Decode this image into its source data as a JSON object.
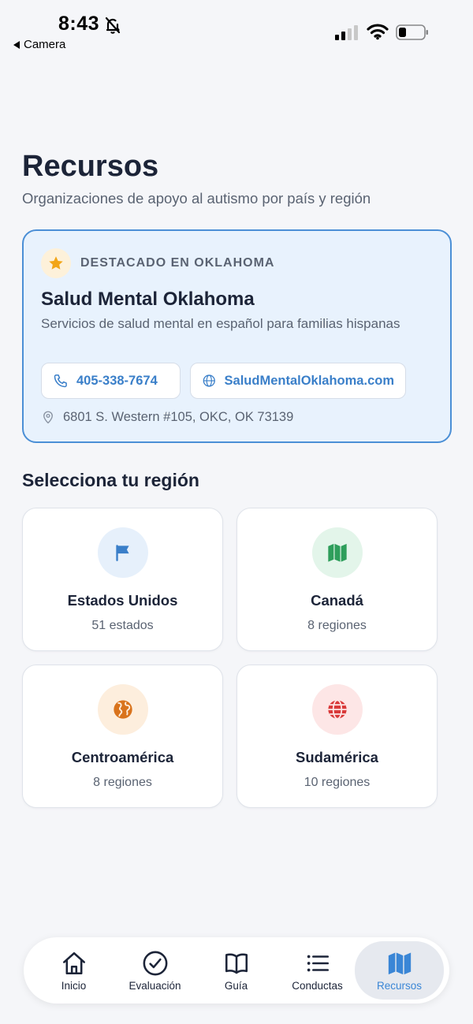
{
  "status_bar": {
    "time": "8:43",
    "back_label": "Camera"
  },
  "header": {
    "title": "Recursos",
    "subtitle": "Organizaciones de apoyo al autismo por país y región"
  },
  "featured": {
    "label": "DESTACADO EN OKLAHOMA",
    "name": "Salud Mental Oklahoma",
    "description": "Servicios de salud mental en español para familias hispanas",
    "phone": "405-338-7674",
    "website": "SaludMentalOklahoma.com",
    "address": "6801 S. Western #105, OKC, OK 73139"
  },
  "regions": {
    "title": "Selecciona tu región",
    "items": [
      {
        "name": "Estados Unidos",
        "count": "51 estados",
        "icon": "flag-icon",
        "color": "#3a7fc9",
        "bg": "#e6f0fb"
      },
      {
        "name": "Canadá",
        "count": "8 regiones",
        "icon": "map-icon",
        "color": "#2e9e5b",
        "bg": "#e3f5ea"
      },
      {
        "name": "Centroamérica",
        "count": "8 regiones",
        "icon": "globe-americas-icon",
        "color": "#d9731c",
        "bg": "#fdeedd"
      },
      {
        "name": "Sudamérica",
        "count": "10 regiones",
        "icon": "globe-grid-icon",
        "color": "#d93a3a",
        "bg": "#fde6e6"
      }
    ]
  },
  "tabs": [
    {
      "label": "Inicio",
      "icon": "home-icon"
    },
    {
      "label": "Evaluación",
      "icon": "check-circle-icon"
    },
    {
      "label": "Guía",
      "icon": "book-icon"
    },
    {
      "label": "Conductas",
      "icon": "list-icon"
    },
    {
      "label": "Recursos",
      "icon": "map-icon",
      "active": true
    }
  ],
  "colors": {
    "accent": "#3a86d6",
    "background": "#f5f6f9",
    "featured_bg": "#e8f2fd",
    "featured_border": "#4b8fd6"
  }
}
